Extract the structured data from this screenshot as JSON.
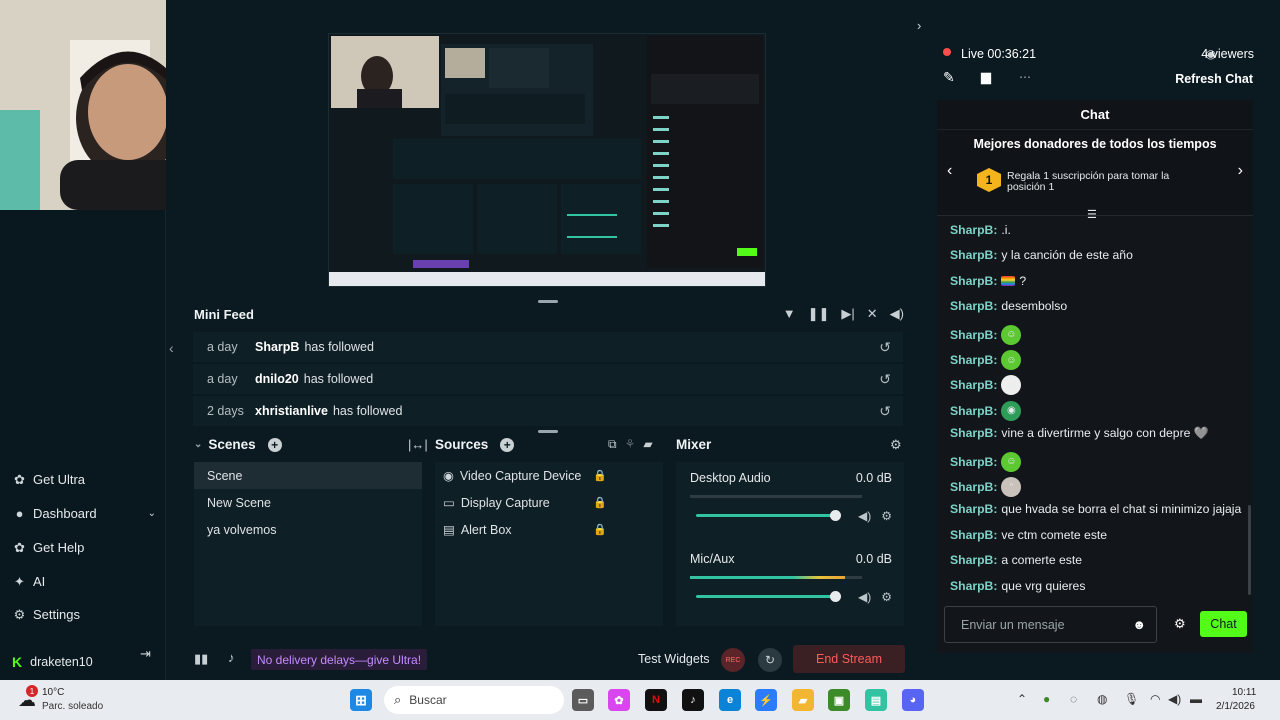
{
  "window": {
    "minimize": "—",
    "maximize": "☐",
    "close": "✕"
  },
  "sidebar": {
    "items": [
      {
        "label": "Get Ultra",
        "icon": "ultra-icon"
      },
      {
        "label": "Dashboard",
        "icon": "dashboard-icon"
      },
      {
        "label": "Get Help",
        "icon": "help-icon"
      },
      {
        "label": "AI",
        "icon": "ai-icon"
      },
      {
        "label": "Settings",
        "icon": "gear-icon"
      }
    ],
    "username": "draketen10"
  },
  "minifeed": {
    "title": "Mini Feed",
    "rows": [
      {
        "when": "a day",
        "who": "SharpB",
        "action": "has followed"
      },
      {
        "when": "a day",
        "who": "dnilo20",
        "action": "has followed"
      },
      {
        "when": "2 days",
        "who": "xhristianlive",
        "action": "has followed"
      }
    ]
  },
  "scenes": {
    "title": "Scenes",
    "items": [
      "Scene",
      "New Scene",
      "ya volvemos"
    ],
    "active": "Scene"
  },
  "sources": {
    "title": "Sources",
    "items": [
      {
        "label": "Video Capture Device",
        "icon": "webcam-icon"
      },
      {
        "label": "Display Capture",
        "icon": "monitor-icon"
      },
      {
        "label": "Alert Box",
        "icon": "bell-icon"
      }
    ]
  },
  "mixer": {
    "title": "Mixer",
    "channels": [
      {
        "name": "Desktop Audio",
        "db": "0.0 dB",
        "volume": 1.0,
        "level": 0.0
      },
      {
        "name": "Mic/Aux",
        "db": "0.0 dB",
        "volume": 1.0,
        "level": 0.9
      }
    ]
  },
  "footer": {
    "ultra_promo": "No delivery delays—give Ultra!",
    "test_widgets": "Test Widgets",
    "rec": "REC",
    "end_stream": "End Stream"
  },
  "stream": {
    "status": "Live",
    "time": "00:36:21",
    "viewers": "4 viewers",
    "refresh_chat": "Refresh Chat"
  },
  "chat": {
    "title": "Chat",
    "donors_title": "Mejores donadores de todos los tiempos",
    "donor_rank": "1",
    "donor_text": "Regala 1 suscripción para tomar la posición 1",
    "messages": [
      {
        "user": "SharpB:",
        "text": ".i.",
        "emote": ""
      },
      {
        "user": "SharpB:",
        "text": "y la canción de este año",
        "emote": ""
      },
      {
        "user": "SharpB:",
        "text": "?",
        "emote": "flag"
      },
      {
        "user": "SharpB:",
        "text": "desembolso",
        "emote": ""
      },
      {
        "user": "SharpB:",
        "text": "",
        "emote": "green-face"
      },
      {
        "user": "SharpB:",
        "text": "",
        "emote": "green-face"
      },
      {
        "user": "SharpB:",
        "text": "",
        "emote": "skull"
      },
      {
        "user": "SharpB:",
        "text": "",
        "emote": "earth"
      },
      {
        "user": "SharpB:",
        "text": "vine a divertirme y salgo con depre 🩶",
        "emote": ""
      },
      {
        "user": "SharpB:",
        "text": "",
        "emote": "green-face"
      },
      {
        "user": "SharpB:",
        "text": "",
        "emote": "cat"
      },
      {
        "user": "SharpB:",
        "text": "que hvada se borra el chat si minimizo jajaja",
        "emote": ""
      },
      {
        "user": "SharpB:",
        "text": "ve ctm comete este",
        "emote": ""
      },
      {
        "user": "SharpB:",
        "text": "a comerte este",
        "emote": ""
      },
      {
        "user": "SharpB:",
        "text": "que vrg quieres",
        "emote": ""
      }
    ],
    "input_placeholder": "Enviar un mensaje",
    "send_label": "Chat"
  },
  "taskbar": {
    "weather_temp": "10°C",
    "weather_desc": "Parc. soleado",
    "weather_badge": "1",
    "search": "Buscar",
    "time": "10:11",
    "date": "2/1/2026"
  },
  "colors": {
    "accent": "#53fc18",
    "live": "#ff4d4d",
    "username": "#7dd3c7",
    "ultra": "#c58bff"
  }
}
